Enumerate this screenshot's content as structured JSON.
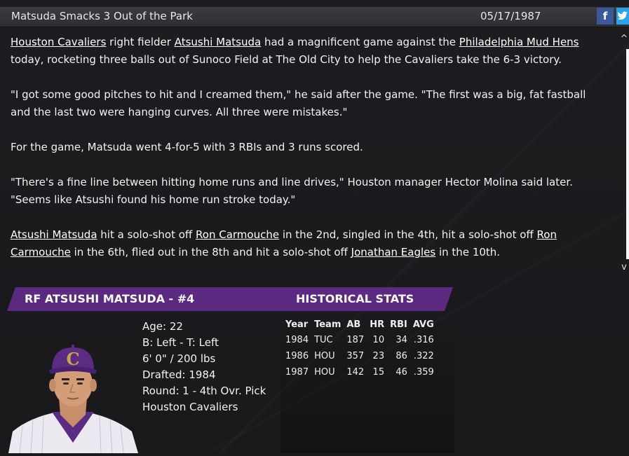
{
  "header": {
    "title": "Matsuda Smacks 3 Out of the Park",
    "date": "05/17/1987",
    "facebook_label": "f",
    "twitter_label": "t"
  },
  "article": {
    "p1": {
      "link_team": "Houston Cavaliers",
      "t1": " right fielder ",
      "link_player": "Atsushi Matsuda",
      "t2": " had a magnificent game against the ",
      "link_opponent": "Philadelphia Mud Hens",
      "t3": " today, rocketing three balls out of Sunoco Field at The Old City to help the Cavaliers take the 6-3 victory."
    },
    "p2": "\"I got some good pitches to hit and I creamed them,\" he said after the game. \"The first was a big, fat fastball and the last two were hanging curves. All three were mistakes.\"",
    "p3": "For the game, Matsuda went 4-for-5 with 3 RBIs and 3 runs scored.",
    "p4": "\"There's a fine line between hitting home runs and line drives,\" Houston manager Hector Molina said later. \"Seems like Atsushi found his home run stroke today.\"",
    "p5": {
      "link_player": "Atsushi Matsuda",
      "t1": " hit a solo-shot off ",
      "link_pitcher1": "Ron Carmouche",
      "t2": " in the 2nd, singled in the 4th, hit a solo-shot off ",
      "link_pitcher2": "Ron Carmouche",
      "t3": " in the 6th, flied out in the 8th and hit a solo-shot off ",
      "link_pitcher3": "Jonathan Eagles",
      "t4": " in the 10th."
    }
  },
  "player": {
    "banner": "RF ATSUSHI MATSUDA - #4",
    "age": "Age: 22",
    "bats_throws": "B: Left - T: Left",
    "size": "6' 0\" / 200 lbs",
    "drafted": "Drafted: 1984",
    "round": "Round: 1 - 4th Ovr. Pick",
    "team": "Houston Cavaliers"
  },
  "stats": {
    "title": "HISTORICAL STATS",
    "headers": [
      "Year",
      "Team",
      "AB",
      "HR",
      "RBI",
      "AVG"
    ],
    "rows": [
      [
        "1984",
        "TUC",
        "187",
        "10",
        "34",
        ".316"
      ],
      [
        "1986",
        "HOU",
        "357",
        "23",
        "86",
        ".322"
      ],
      [
        "1987",
        "HOU",
        "142",
        "15",
        "46",
        ".359"
      ]
    ]
  },
  "scrollbar": {
    "up": "^",
    "down": "v"
  },
  "colors": {
    "banner": "#5b2a80",
    "cap": "#5a2d82",
    "logo": "#c9a24a"
  }
}
